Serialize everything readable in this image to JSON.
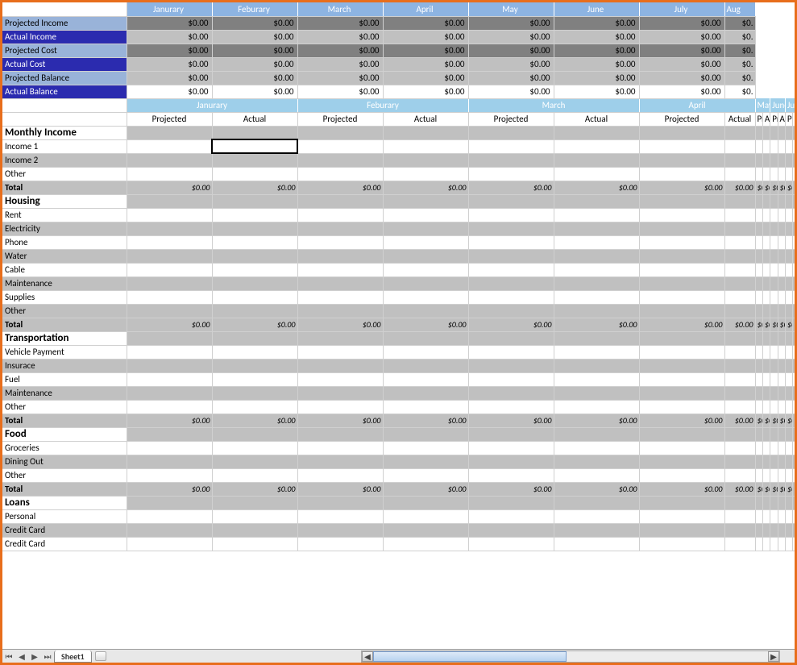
{
  "months": [
    "Janurary",
    "Feburary",
    "March",
    "April",
    "May",
    "June",
    "July",
    "Aug"
  ],
  "subcols": [
    "Projected",
    "Actual"
  ],
  "zero": "$0.00",
  "partial": "$0.",
  "summary_rows": [
    {
      "label": "Projected Income",
      "labelClass": "row-lt",
      "valClass": "val-gray"
    },
    {
      "label": "Actual Income",
      "labelClass": "row-dk",
      "valClass": "val-ltgray"
    },
    {
      "label": "Projected Cost",
      "labelClass": "row-lt",
      "valClass": "val-gray"
    },
    {
      "label": "Actual Cost",
      "labelClass": "row-dk",
      "valClass": "val-ltgray"
    },
    {
      "label": "Projected Balance",
      "labelClass": "row-lt",
      "valClass": "val-ltgray"
    },
    {
      "label": "Actual Balance",
      "labelClass": "row-dk",
      "valClass": "val-white"
    }
  ],
  "sections": [
    {
      "title": "Monthly Income",
      "rows": [
        "Income 1",
        "Income 2",
        "Other"
      ]
    },
    {
      "title": "Housing",
      "rows": [
        "Rent",
        "Electricity",
        "Phone",
        "Water",
        "Cable",
        "Maintenance",
        "Supplies",
        "Other"
      ]
    },
    {
      "title": "Transportation",
      "rows": [
        "Vehicle Payment",
        "Insurace",
        "Fuel",
        "Maintenance",
        "Other"
      ]
    },
    {
      "title": "Food",
      "rows": [
        "Groceries",
        "Dining Out",
        "Other"
      ]
    },
    {
      "title": "Loans",
      "rows": [
        "Personal",
        "Credit Card",
        "Credit Card"
      ],
      "no_total": true
    }
  ],
  "total_label": "Total",
  "sheet_tab": "Sheet1",
  "selected_cell": {
    "section": 0,
    "row": 0,
    "col": 1
  }
}
